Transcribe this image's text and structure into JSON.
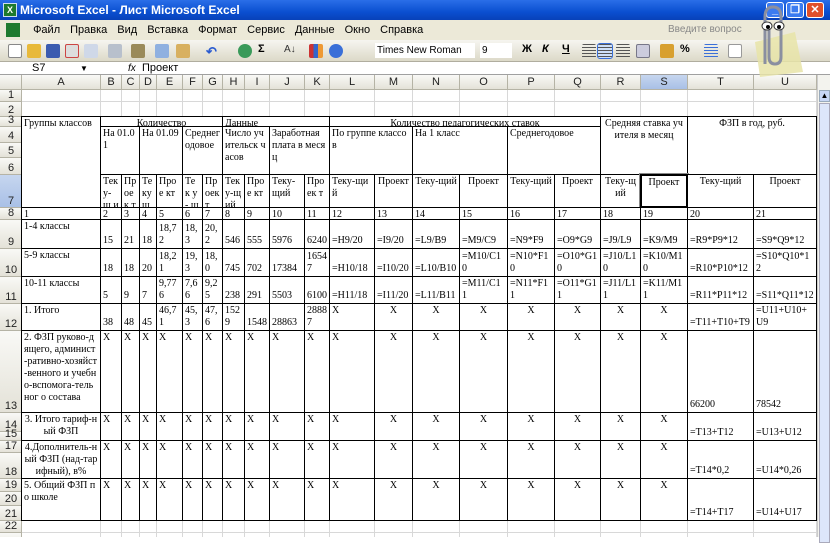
{
  "window": {
    "title": "Microsoft Excel - Лист Microsoft Excel",
    "minimize": "_",
    "restore": "❐",
    "close": "✕"
  },
  "menu": [
    "Файл",
    "Правка",
    "Вид",
    "Вставка",
    "Формат",
    "Сервис",
    "Данные",
    "Окно",
    "Справка"
  ],
  "help_placeholder": "Введите вопрос",
  "toolbar": {
    "font": "Times New Roman",
    "size": "9",
    "bold": "Ж",
    "italic": "К",
    "underline": "Ч",
    "sigma": "Σ",
    "percent": "%"
  },
  "formula_bar": {
    "name_box": "S7",
    "fx": "fx",
    "value": "Проект"
  },
  "selected": {
    "col": "S",
    "row": 7
  },
  "columns": [
    "A",
    "B",
    "C",
    "D",
    "E",
    "F",
    "G",
    "H",
    "I",
    "J",
    "K",
    "L",
    "M",
    "N",
    "O",
    "P",
    "Q",
    "R",
    "S",
    "T",
    "U"
  ],
  "rows": [
    1,
    2,
    3,
    4,
    5,
    6,
    7,
    8,
    9,
    10,
    11,
    12,
    13,
    14,
    15,
    16,
    17,
    18,
    19,
    20,
    21,
    22,
    23
  ],
  "hidden_rows": [
    16
  ],
  "header_cells": [
    {
      "ref": "A3:A7",
      "text": "Группы классов",
      "h": "l",
      "v": "top"
    },
    {
      "ref": "B3:G3",
      "text": "Количество",
      "h": "c",
      "v": "top"
    },
    {
      "ref": "H3:K3",
      "text": "Данные",
      "h": "l",
      "v": "top"
    },
    {
      "ref": "L3:Q3",
      "text": "Количество педагогических ставок",
      "h": "c",
      "v": "top"
    },
    {
      "ref": "R3:S6",
      "text": "Средняя ставка учителя в месяц",
      "h": "c",
      "v": "top"
    },
    {
      "ref": "T3:U6",
      "text": "ФЗП в год, руб.",
      "h": "c",
      "v": "top"
    },
    {
      "ref": "B4:C6",
      "text": "На 01.01",
      "h": "l",
      "v": "top"
    },
    {
      "ref": "D4:E6",
      "text": "На 01.09",
      "h": "l",
      "v": "top"
    },
    {
      "ref": "F4:G6",
      "text": "Среднег одовое",
      "h": "l",
      "v": "top"
    },
    {
      "ref": "H4:I6",
      "text": "Число учительск часов",
      "h": "l",
      "v": "top"
    },
    {
      "ref": "J4:K6",
      "text": "Заработная плата в месяц",
      "h": "l",
      "v": "top"
    },
    {
      "ref": "L4:M6",
      "text": "По группе классов",
      "h": "l",
      "v": "top"
    },
    {
      "ref": "N4:O6",
      "text": "На 1 класс",
      "h": "l",
      "v": "top"
    },
    {
      "ref": "P4:Q6",
      "text": "Среднегодовое",
      "h": "l",
      "v": "top"
    }
  ],
  "row7": [
    "Тек у-щ ий",
    "Пр оек т",
    "Те ку щий",
    "Прое кт",
    "Тек у- щий",
    "Пр оек т",
    "Тек у-щ ий",
    "Прое кт",
    "Теку- щий",
    "Проек т",
    "Теку-щи й",
    "Проект",
    "Теку-щий",
    "Проект",
    "Теку-щий",
    "Проект",
    "Теку-щ ий",
    "Проект",
    "Теку-щий",
    "Проект"
  ],
  "row8": [
    "1",
    "2",
    "3",
    "4",
    "5",
    "6",
    "7",
    "8",
    "9",
    "10",
    "11",
    "12",
    "13",
    "14",
    "15",
    "16",
    "17",
    "18",
    "19",
    "20",
    "21"
  ],
  "body": [
    {
      "rows": "9:9",
      "values": [
        "1-4 классы",
        "15",
        "21",
        "18",
        "18,72",
        "18,3",
        "20,2",
        "546",
        "555",
        "5976",
        "6240",
        "=H9/20",
        "=I9/20",
        "=L9/B9",
        "=M9/C9",
        "=N9*F9",
        "=O9*G9",
        "=J9/L9",
        "=K9/M9",
        "=R9*P9*12",
        "=S9*Q9*12"
      ]
    },
    {
      "rows": "10:10",
      "values": [
        "5-9 классы",
        "18",
        "18",
        "20",
        "18,21",
        "19,3",
        "18,0",
        "745",
        "702",
        "17384",
        "16547",
        "=H10/18",
        "=I10/20",
        "=L10/B10",
        "=M10/C10",
        "=N10*F10",
        "=O10*G10",
        "=J10/L10",
        "=K10/M10",
        "=R10*P10*12",
        "=S10*Q10*12"
      ]
    },
    {
      "rows": "11:11",
      "values": [
        "10-11 классы",
        "5",
        "9",
        "7",
        "9,776",
        "7,66",
        "9,25",
        "238",
        "291",
        "5503",
        "6100",
        "=H11/18",
        "=I11/20",
        "=L11/B11",
        "=M11/C11",
        "=N11*F11",
        "=O11*G11",
        "=J11/L11",
        "=K11/M11",
        "=R11*P11*12",
        "=S11*Q11*12"
      ]
    },
    {
      "rows": "12:12",
      "values": [
        "1. Итого",
        "38",
        "48",
        "45",
        "46,71",
        "45,3",
        "47,6",
        "1529",
        "1548",
        "28863",
        "28887",
        "X",
        "X",
        "X",
        "X",
        "X",
        "X",
        "X",
        "X",
        "=T11+T10+T9",
        "=U11+U10+U9"
      ]
    },
    {
      "rows": "13:13",
      "values": [
        "2. ФЗП руково-дящего, админист-ративно-хозяйст-венного и учебно-вспомога-тельног о состава",
        "X",
        "X",
        "X",
        "X",
        "X",
        "X",
        "X",
        "X",
        "X",
        "X",
        "X",
        "X",
        "X",
        "X",
        "X",
        "X",
        "X",
        "X",
        "66200",
        "78542"
      ]
    },
    {
      "rows": "14:15",
      "values": [
        "3. Итого тариф-ный ФЗП",
        "X",
        "X",
        "X",
        "X",
        "X",
        "X",
        "X",
        "X",
        "X",
        "X",
        "X",
        "X",
        "X",
        "X",
        "X",
        "X",
        "X",
        "X",
        "=T13+T12",
        "=U13+U12"
      ]
    },
    {
      "rows": "17:18",
      "values": [
        "4.Дополнитель-ный ФЗП (над-тарифный), в%",
        "X",
        "X",
        "X",
        "X",
        "X",
        "X",
        "X",
        "X",
        "X",
        "X",
        "X",
        "X",
        "X",
        "X",
        "X",
        "X",
        "X",
        "X",
        "=T14*0,2",
        "=U14*0,26"
      ]
    },
    {
      "rows": "19:21",
      "values": [
        "5. Общий ФЗП по школе",
        "X",
        "X",
        "X",
        "X",
        "X",
        "X",
        "X",
        "X",
        "X",
        "X",
        "X",
        "X",
        "X",
        "X",
        "X",
        "X",
        "X",
        "X",
        "=T14+T17",
        "=U14+U17"
      ]
    }
  ]
}
